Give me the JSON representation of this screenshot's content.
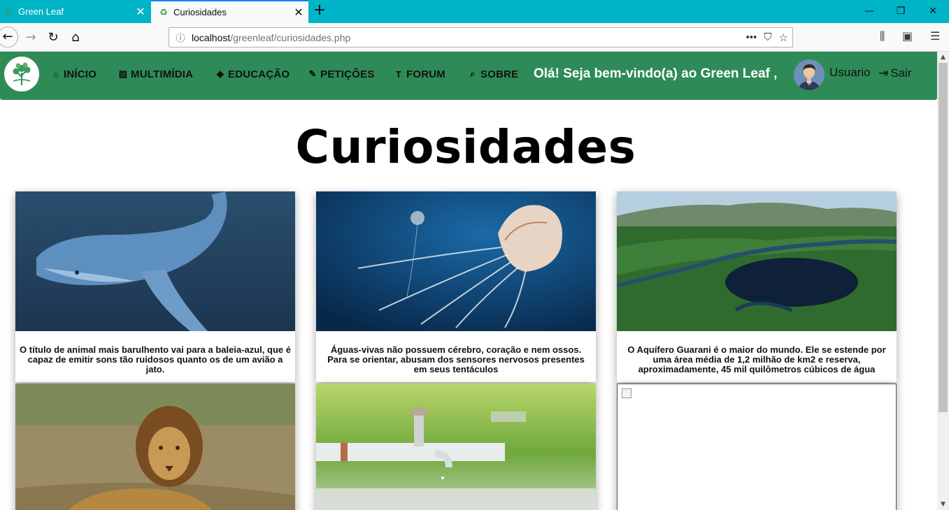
{
  "browser": {
    "tabs": [
      {
        "title": "Green Leaf",
        "active": false
      },
      {
        "title": "Curiosidades",
        "active": true
      }
    ],
    "url_host": "localhost",
    "url_path": "/greenleaf/curiosidades.php"
  },
  "site": {
    "nav": [
      {
        "label": "INÍCIO",
        "icon": "home-icon"
      },
      {
        "label": "MULTIMÍDIA",
        "icon": "image-icon"
      },
      {
        "label": "EDUCAÇÃO",
        "icon": "graduation-cap-icon"
      },
      {
        "label": "PETIÇÕES",
        "icon": "pencil-icon"
      },
      {
        "label": "FORUM",
        "icon": "text-height-icon"
      },
      {
        "label": "SOBRE",
        "icon": "search-icon"
      }
    ],
    "welcome": "Olá! Seja bem-vindo(a) ao Green Leaf ,",
    "username": "Usuario",
    "logout": "Sair",
    "brand_color": "#2e8b57"
  },
  "page": {
    "title": "Curiosidades",
    "cards": [
      {
        "image": "blue-whale",
        "caption": "O título de animal mais barulhento vai para a baleia-azul, que é capaz de emitir sons tão ruidosos quanto os de um avião a jato."
      },
      {
        "image": "jellyfish",
        "caption": "Águas-vivas não possuem cérebro, coração e nem ossos. Para se orientar, abusam dos sensores nervosos presentes em seus tentáculos"
      },
      {
        "image": "aquifer-landscape",
        "caption": "O Aquífero Guarani é o maior do mundo. Ele se estende por uma área média de 1,2 milhão de km2 e reserva, aproximadamente, 45 mil quilômetros cúbicos de água"
      },
      {
        "image": "lion",
        "caption": ""
      },
      {
        "image": "water-faucet",
        "caption": ""
      },
      {
        "image": "broken-image",
        "caption": ""
      }
    ]
  }
}
